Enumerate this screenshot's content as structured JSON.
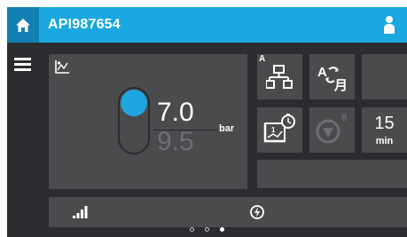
{
  "header": {
    "title": "API987654",
    "home_icon": "home-icon",
    "user_icon": "user-icon"
  },
  "sidebar": {
    "menu_icon": "hamburger-menu-icon"
  },
  "pressure": {
    "setpoint": "7.0",
    "actual": "9.5",
    "unit": "bar",
    "toggle_on": true,
    "accent": "#1fa5e0"
  },
  "tiles": {
    "network_superscript": "A",
    "language_icon": "language-icon",
    "count_superscript": "8",
    "timer_value": "15",
    "timer_unit": "min"
  },
  "bottom": {
    "signal_icon": "signal-bars-icon",
    "power_icon": "power-icon"
  },
  "pager": {
    "pages": 3,
    "active": 3
  }
}
